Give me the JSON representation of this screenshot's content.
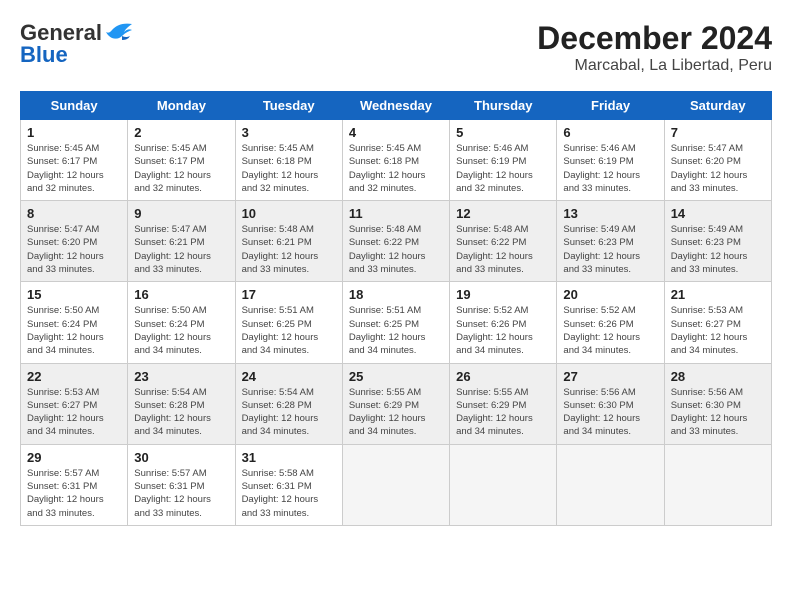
{
  "logo": {
    "general": "General",
    "blue": "Blue"
  },
  "title": "December 2024",
  "subtitle": "Marcabal, La Libertad, Peru",
  "weekdays": [
    "Sunday",
    "Monday",
    "Tuesday",
    "Wednesday",
    "Thursday",
    "Friday",
    "Saturday"
  ],
  "weeks": [
    [
      {
        "day": 1,
        "info": "Sunrise: 5:45 AM\nSunset: 6:17 PM\nDaylight: 12 hours\nand 32 minutes."
      },
      {
        "day": 2,
        "info": "Sunrise: 5:45 AM\nSunset: 6:17 PM\nDaylight: 12 hours\nand 32 minutes."
      },
      {
        "day": 3,
        "info": "Sunrise: 5:45 AM\nSunset: 6:18 PM\nDaylight: 12 hours\nand 32 minutes."
      },
      {
        "day": 4,
        "info": "Sunrise: 5:45 AM\nSunset: 6:18 PM\nDaylight: 12 hours\nand 32 minutes."
      },
      {
        "day": 5,
        "info": "Sunrise: 5:46 AM\nSunset: 6:19 PM\nDaylight: 12 hours\nand 32 minutes."
      },
      {
        "day": 6,
        "info": "Sunrise: 5:46 AM\nSunset: 6:19 PM\nDaylight: 12 hours\nand 33 minutes."
      },
      {
        "day": 7,
        "info": "Sunrise: 5:47 AM\nSunset: 6:20 PM\nDaylight: 12 hours\nand 33 minutes."
      }
    ],
    [
      {
        "day": 8,
        "info": "Sunrise: 5:47 AM\nSunset: 6:20 PM\nDaylight: 12 hours\nand 33 minutes."
      },
      {
        "day": 9,
        "info": "Sunrise: 5:47 AM\nSunset: 6:21 PM\nDaylight: 12 hours\nand 33 minutes."
      },
      {
        "day": 10,
        "info": "Sunrise: 5:48 AM\nSunset: 6:21 PM\nDaylight: 12 hours\nand 33 minutes."
      },
      {
        "day": 11,
        "info": "Sunrise: 5:48 AM\nSunset: 6:22 PM\nDaylight: 12 hours\nand 33 minutes."
      },
      {
        "day": 12,
        "info": "Sunrise: 5:48 AM\nSunset: 6:22 PM\nDaylight: 12 hours\nand 33 minutes."
      },
      {
        "day": 13,
        "info": "Sunrise: 5:49 AM\nSunset: 6:23 PM\nDaylight: 12 hours\nand 33 minutes."
      },
      {
        "day": 14,
        "info": "Sunrise: 5:49 AM\nSunset: 6:23 PM\nDaylight: 12 hours\nand 33 minutes."
      }
    ],
    [
      {
        "day": 15,
        "info": "Sunrise: 5:50 AM\nSunset: 6:24 PM\nDaylight: 12 hours\nand 34 minutes."
      },
      {
        "day": 16,
        "info": "Sunrise: 5:50 AM\nSunset: 6:24 PM\nDaylight: 12 hours\nand 34 minutes."
      },
      {
        "day": 17,
        "info": "Sunrise: 5:51 AM\nSunset: 6:25 PM\nDaylight: 12 hours\nand 34 minutes."
      },
      {
        "day": 18,
        "info": "Sunrise: 5:51 AM\nSunset: 6:25 PM\nDaylight: 12 hours\nand 34 minutes."
      },
      {
        "day": 19,
        "info": "Sunrise: 5:52 AM\nSunset: 6:26 PM\nDaylight: 12 hours\nand 34 minutes."
      },
      {
        "day": 20,
        "info": "Sunrise: 5:52 AM\nSunset: 6:26 PM\nDaylight: 12 hours\nand 34 minutes."
      },
      {
        "day": 21,
        "info": "Sunrise: 5:53 AM\nSunset: 6:27 PM\nDaylight: 12 hours\nand 34 minutes."
      }
    ],
    [
      {
        "day": 22,
        "info": "Sunrise: 5:53 AM\nSunset: 6:27 PM\nDaylight: 12 hours\nand 34 minutes."
      },
      {
        "day": 23,
        "info": "Sunrise: 5:54 AM\nSunset: 6:28 PM\nDaylight: 12 hours\nand 34 minutes."
      },
      {
        "day": 24,
        "info": "Sunrise: 5:54 AM\nSunset: 6:28 PM\nDaylight: 12 hours\nand 34 minutes."
      },
      {
        "day": 25,
        "info": "Sunrise: 5:55 AM\nSunset: 6:29 PM\nDaylight: 12 hours\nand 34 minutes."
      },
      {
        "day": 26,
        "info": "Sunrise: 5:55 AM\nSunset: 6:29 PM\nDaylight: 12 hours\nand 34 minutes."
      },
      {
        "day": 27,
        "info": "Sunrise: 5:56 AM\nSunset: 6:30 PM\nDaylight: 12 hours\nand 34 minutes."
      },
      {
        "day": 28,
        "info": "Sunrise: 5:56 AM\nSunset: 6:30 PM\nDaylight: 12 hours\nand 33 minutes."
      }
    ],
    [
      {
        "day": 29,
        "info": "Sunrise: 5:57 AM\nSunset: 6:31 PM\nDaylight: 12 hours\nand 33 minutes."
      },
      {
        "day": 30,
        "info": "Sunrise: 5:57 AM\nSunset: 6:31 PM\nDaylight: 12 hours\nand 33 minutes."
      },
      {
        "day": 31,
        "info": "Sunrise: 5:58 AM\nSunset: 6:31 PM\nDaylight: 12 hours\nand 33 minutes."
      },
      null,
      null,
      null,
      null
    ]
  ]
}
